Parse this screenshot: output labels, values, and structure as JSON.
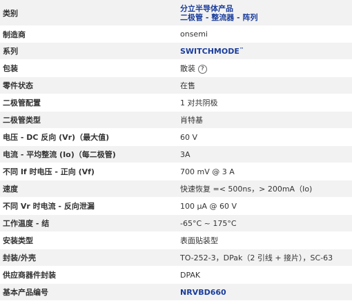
{
  "rows": [
    {
      "label": "类别",
      "value_lines": [
        "分立半导体产品",
        "二极管 - 整流器 - 阵列"
      ],
      "link": true
    },
    {
      "label": "制造商",
      "value": "onsemi"
    },
    {
      "label": "系列",
      "value": "SWITCHMODE",
      "tm": "™",
      "link": true
    },
    {
      "label": "包装",
      "value": "散装",
      "help_icon": "question-circle-icon",
      "help_glyph": "?"
    },
    {
      "label": "零件状态",
      "value": "在售"
    },
    {
      "label": "二极管配置",
      "value": "1 对共阴极"
    },
    {
      "label": "二极管类型",
      "value": "肖特基"
    },
    {
      "label": "电压 - DC 反向 (Vr)（最大值)",
      "value": "60 V"
    },
    {
      "label": "电流 - 平均整流 (Io)（每二极管)",
      "value": "3A"
    },
    {
      "label": "不同 If 时电压 - 正向 (Vf)",
      "value": "700 mV @ 3 A"
    },
    {
      "label": "速度",
      "value": "快速恢复 =< 500ns，> 200mA（Io)"
    },
    {
      "label": "不同 Vr 时电流 - 反向泄漏",
      "value": "100 µA @ 60 V"
    },
    {
      "label": "工作温度 - 结",
      "value": "-65°C ~ 175°C"
    },
    {
      "label": "安装类型",
      "value": "表面贴装型"
    },
    {
      "label": "封装/外壳",
      "value": "TO-252-3，DPak（2 引线 + 接片），SC-63"
    },
    {
      "label": "供应商器件封装",
      "value": "DPAK"
    },
    {
      "label": "基本产品编号",
      "value": "NRVBD660",
      "link": true
    }
  ]
}
